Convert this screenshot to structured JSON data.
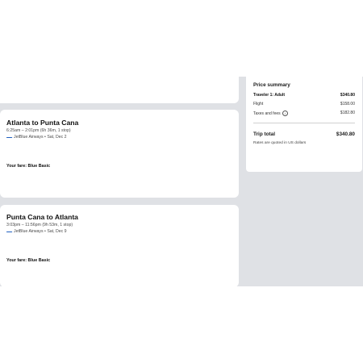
{
  "flights": [
    {
      "title": "Atlanta to Punta Cana",
      "time": "6:25am – 2:01pm (6h 36m, 1 stop)",
      "airline": "JetBlue Airways • Sat, Dec 2",
      "fare": "Your fare: Blue Basic"
    },
    {
      "title": "Punta Cana to Atlanta",
      "time": "3:03pm – 11:56pm (9h 53m, 1 stop)",
      "airline": "JetBlue Airways • Sat, Dec 9",
      "fare": "Your fare: Blue Basic"
    }
  ],
  "summary": {
    "title": "Price summary",
    "traveler_label": "Traveler 1: Adult",
    "traveler_value": "$340.80",
    "flight_label": "Flight",
    "flight_value": "$158.00",
    "taxes_label": "Taxes and fees",
    "taxes_value": "$182.80",
    "total_label": "Trip total",
    "total_value": "$340.80",
    "note": "Rates are quoted in US dollars"
  },
  "icons": {
    "airline": "jetblue-logo-icon",
    "info": "info-icon"
  }
}
